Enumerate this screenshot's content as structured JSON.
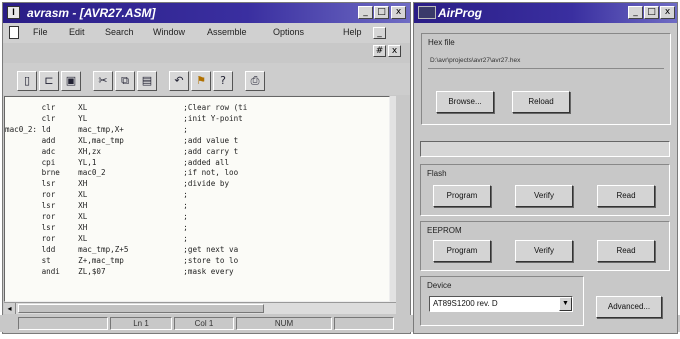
{
  "editor_window": {
    "title": "avrasm - [AVR27.ASM]",
    "title_icon": "I",
    "buttons": {
      "minimize": "_",
      "maximize": "□",
      "close": "x"
    },
    "menu": [
      "File",
      "Edit",
      "Search",
      "Window",
      "Assemble",
      "Options",
      "Help"
    ],
    "child_buttons": {
      "minimize": "_",
      "restore": "#",
      "close": "x"
    },
    "toolbar_icons": [
      "new-file-icon",
      "open-file-icon",
      "save-icon",
      "cut-icon",
      "copy-icon",
      "paste-icon",
      "undo-icon",
      "assemble-icon",
      "help-icon",
      "print-icon"
    ],
    "code_lines": [
      "        clr     XL                     ;Clear row (ti",
      "        clr     YL                     ;init Y-point",
      "mac0_2: ld      mac_tmp,X+             ;",
      "        add     XL,mac_tmp             ;add value t",
      "        adc     XH,zx                  ;add carry t",
      "        cpi     YL,1                   ;added all",
      "        brne    mac0_2                 ;if not, loo",
      "        lsr     XH                     ;divide by",
      "        ror     XL                     ;",
      "        lsr     XH                     ;",
      "        ror     XL                     ;",
      "        lsr     XH                     ;",
      "        ror     XL                     ;",
      "        ldd     mac_tmp,Z+5            ;get next va",
      "        st      Z+,mac_tmp             ;store to lo",
      "        andi    ZL,$07                 ;mask every"
    ],
    "status": {
      "line": "Ln 1",
      "col": "Col 1",
      "num": "NUM"
    }
  },
  "airprog_window": {
    "title": "AirProg",
    "title_icon": "airprog-logo-icon",
    "buttons": {
      "minimize": "_",
      "maximize": "□",
      "close": "x"
    },
    "hex_file": {
      "label": "Hex file",
      "path": "D:\\avr\\projects\\avr27\\avr27.hex",
      "browse": "Browse...",
      "reload": "Reload"
    },
    "progress": {
      "value": 0
    },
    "flash": {
      "label": "Flash",
      "program": "Program",
      "verify": "Verify",
      "read": "Read"
    },
    "eeprom": {
      "label": "EEPROM",
      "program": "Program",
      "verify": "Verify",
      "read": "Read"
    },
    "device": {
      "label": "Device",
      "selected": "AT89S1200 rev. D",
      "advanced": "Advanced..."
    }
  },
  "colors": {
    "titlebar": "#2a1d86",
    "window_bg": "#c8c8c8",
    "editor_bg": "#fbfbf7"
  }
}
